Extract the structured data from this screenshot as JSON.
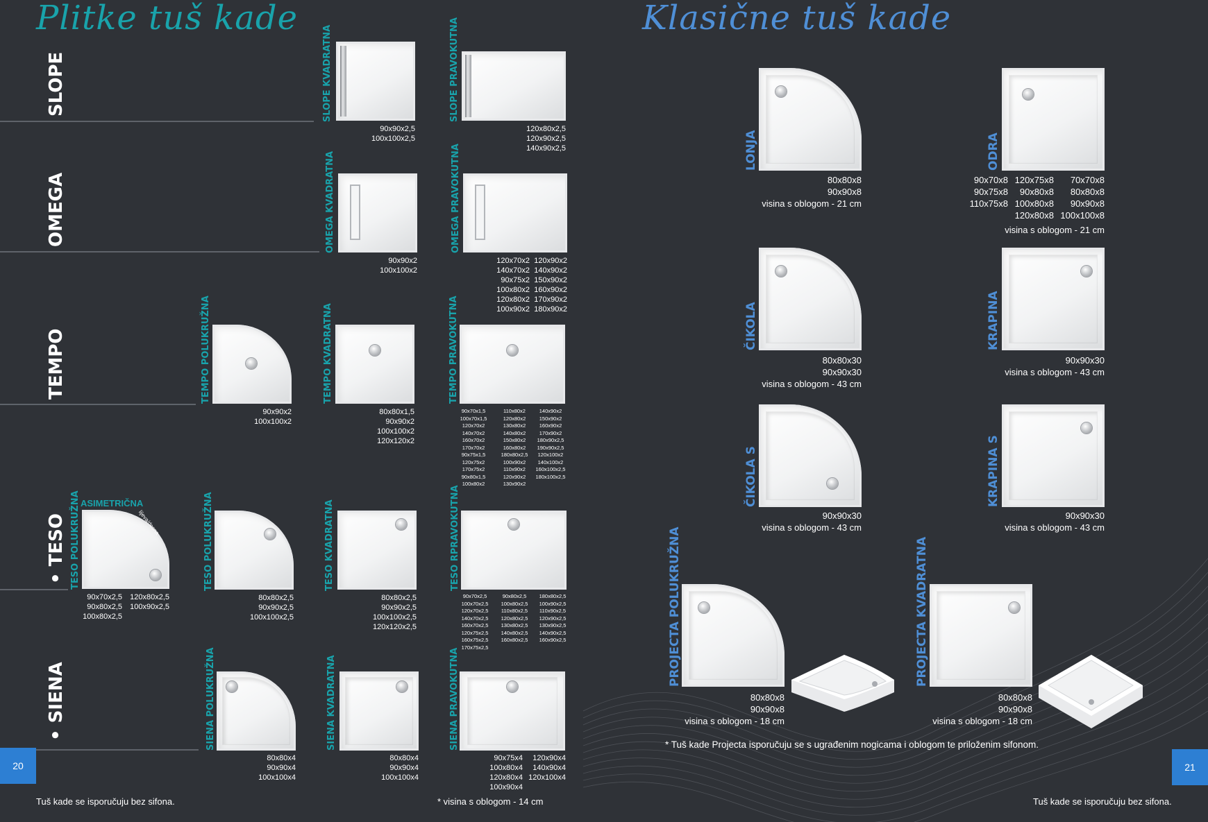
{
  "left_title": "Plitke tuš kade",
  "right_title": "Klasične tuš kade",
  "categories": {
    "slope": "SLOPE",
    "omega": "OMEGA",
    "tempo": "TEMPO",
    "teso": "• TESO",
    "siena": "• SIENA"
  },
  "labels": {
    "slope_kv": "SLOPE KVADRATNA",
    "slope_pr": "SLOPE PRAVOKUTNA",
    "omega_kv": "OMEGA KVADRATNA",
    "omega_pr": "OMEGA PRAVOKUTNA",
    "tempo_po": "TEMPO POLUKRUŽNA",
    "tempo_kv": "TEMPO KVADRATNA",
    "tempo_pr": "TEMPO PRAVOKUTNA",
    "teso_po_a": "TESO POLUKRUŽNA",
    "teso_asim": "ASIMETRIČNA",
    "teso_lijeva": "lijeva/desna",
    "teso_po": "TESO POLUKRUŽNA",
    "teso_kv": "TESO KVADRATNA",
    "teso_pr": "TESO RPRAVOKUTNA",
    "siena_po": "SIENA POLUKRUŽNA",
    "siena_kv": "SIENA KVADRATNA",
    "siena_pr": "SIENA PRAVOKUTNA",
    "lonja": "LONJA",
    "odra": "ODRA",
    "cikola": "ČIKOLA",
    "krapina": "KRAPINA",
    "cikola_s": "ČIKOLA S",
    "krapina_s": "KRAPINA S",
    "projecta_po": "PROJECTA POLUKRUŽNA",
    "projecta_kv": "PROJECTA KVADRATNA"
  },
  "sizes": {
    "slope_kv": [
      "90x90x2,5",
      "100x100x2,5"
    ],
    "slope_pr": [
      "120x80x2,5",
      "120x90x2,5",
      "140x90x2,5"
    ],
    "omega_kv": [
      "90x90x2",
      "100x100x2"
    ],
    "omega_pr_a": [
      "120x70x2",
      "140x70x2",
      "90x75x2",
      "100x80x2",
      "120x80x2",
      "100x90x2"
    ],
    "omega_pr_b": [
      "120x90x2",
      "140x90x2",
      "150x90x2",
      "160x90x2",
      "170x90x2",
      "180x90x2"
    ],
    "tempo_po": [
      "90x90x2",
      "100x100x2"
    ],
    "tempo_kv": [
      "80x80x1,5",
      "90x90x2",
      "100x100x2",
      "120x120x2"
    ],
    "tempo_pr_a": [
      "90x70x1,5",
      "100x70x1,5",
      "120x70x2",
      "140x70x2",
      "160x70x2",
      "170x70x2",
      "90x75x1,5",
      "120x75x2",
      "170x75x2",
      "90x80x1,5",
      "100x80x2"
    ],
    "tempo_pr_b": [
      "110x80x2",
      "120x80x2",
      "130x80x2",
      "140x80x2",
      "150x80x2",
      "160x80x2",
      "180x80x2,5",
      "100x90x2",
      "110x90x2",
      "120x90x2",
      "130x90x2"
    ],
    "tempo_pr_c": [
      "140x90x2",
      "150x90x2",
      "160x90x2",
      "170x90x2",
      "180x90x2,5",
      "190x90x2,5",
      "120x100x2",
      "140x100x2",
      "160x100x2,5",
      "180x100x2,5"
    ],
    "teso_a1": [
      "90x70x2,5",
      "90x80x2,5",
      "100x80x2,5"
    ],
    "teso_a2": [
      "120x80x2,5",
      "100x90x2,5"
    ],
    "teso_po": [
      "80x80x2,5",
      "90x90x2,5",
      "100x100x2,5"
    ],
    "teso_kv": [
      "80x80x2,5",
      "90x90x2,5",
      "100x100x2,5",
      "120x120x2,5"
    ],
    "teso_pr_a": [
      "90x70x2,5",
      "100x70x2,5",
      "120x70x2,5",
      "140x70x2,5",
      "160x70x2,5",
      "120x75x2,5",
      "160x75x2,5",
      "170x75x2,5"
    ],
    "teso_pr_b": [
      "90x80x2,5",
      "100x80x2,5",
      "110x80x2,5",
      "120x80x2,5",
      "130x80x2,5",
      "140x80x2,5",
      "160x80x2,5"
    ],
    "teso_pr_c": [
      "180x80x2,5",
      "100x90x2,5",
      "110x90x2,5",
      "120x90x2,5",
      "130x90x2,5",
      "140x90x2,5",
      "160x90x2,5"
    ],
    "siena_po": [
      "80x80x4",
      "90x90x4",
      "100x100x4"
    ],
    "siena_kv": [
      "80x80x4",
      "90x90x4",
      "100x100x4"
    ],
    "siena_pr_a": [
      "90x75x4",
      "100x80x4",
      "120x80x4",
      "100x90x4"
    ],
    "siena_pr_b": [
      "120x90x4",
      "140x90x4",
      "120x100x4"
    ],
    "lonja": [
      "80x80x8",
      "90x90x8",
      "visina s oblogom - 21 cm"
    ],
    "odra_a": [
      "90x70x8",
      "90x75x8",
      "110x75x8"
    ],
    "odra_b": [
      "120x75x8",
      "90x80x8",
      "100x80x8",
      "120x80x8"
    ],
    "odra_c": [
      "70x70x8",
      "80x80x8",
      "90x90x8",
      "100x100x8"
    ],
    "odra_h": "visina s oblogom - 21 cm",
    "cikola": [
      "80x80x30",
      "90x90x30",
      "visina s oblogom - 43 cm"
    ],
    "krapina": [
      "90x90x30",
      "visina s oblogom - 43 cm"
    ],
    "cikola_s": [
      "90x90x30",
      "visina s oblogom - 43 cm"
    ],
    "krapina_s": [
      "90x90x30",
      "visina s oblogom - 43 cm"
    ],
    "projecta_po": [
      "80x80x8",
      "90x90x8",
      "visina s oblogom - 18 cm"
    ],
    "projecta_kv": [
      "80x80x8",
      "90x90x8",
      "visina s oblogom - 18 cm"
    ]
  },
  "notes": {
    "projecta": "* Tuš kade Projecta isporučuju se s ugrađenim nogicama i oblogom te priloženim sifonom.",
    "left_foot": "Tuš kade se isporučuju bez sifona.",
    "mid_foot": "* visina s oblogom - 14 cm",
    "right_foot": "Tuš kade se isporučuju bez sifona."
  },
  "page_left": "20",
  "page_right": "21",
  "colors": {
    "background": "#2f3237",
    "teal": "#19a3ab",
    "blue": "#4f8fd6",
    "page_box": "#2d7fd3"
  }
}
